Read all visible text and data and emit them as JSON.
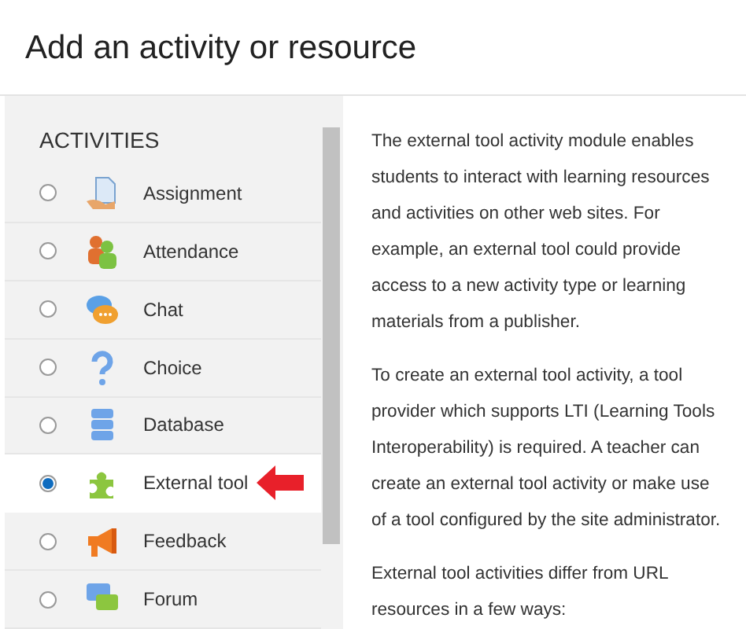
{
  "dialog": {
    "title": "Add an activity or resource"
  },
  "activities": {
    "heading": "ACTIVITIES",
    "items": [
      {
        "label": "Assignment",
        "kind": "document",
        "selected": false
      },
      {
        "label": "Attendance",
        "kind": "people",
        "selected": false
      },
      {
        "label": "Chat",
        "kind": "chat",
        "selected": false
      },
      {
        "label": "Choice",
        "kind": "question",
        "selected": false
      },
      {
        "label": "Database",
        "kind": "database",
        "selected": false
      },
      {
        "label": "External tool",
        "kind": "puzzle",
        "selected": true
      },
      {
        "label": "Feedback",
        "kind": "megaphone",
        "selected": false
      },
      {
        "label": "Forum",
        "kind": "forum",
        "selected": false
      }
    ]
  },
  "description": [
    "The external tool activity module enables students to interact with learning resources and activities on other web sites. For example, an external tool could provide access to a new activity type or learning materials from a publisher.",
    "To create an external tool activity, a tool provider which supports LTI (Learning Tools Interoperability) is required. A teacher can create an external tool activity or make use of a tool configured by the site administrator.",
    "External tool activities differ from URL resources in a few ways:"
  ]
}
